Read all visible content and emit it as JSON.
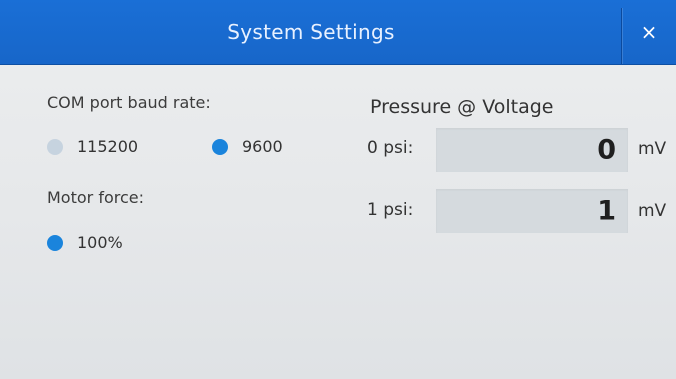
{
  "window": {
    "title": "System Settings",
    "close_glyph": "×"
  },
  "baud": {
    "label": "COM port baud rate:",
    "options": [
      {
        "label": "115200",
        "selected": false
      },
      {
        "label": "9600",
        "selected": true
      }
    ]
  },
  "motor": {
    "label": "Motor force:",
    "options": [
      {
        "label": "100%",
        "selected": true
      }
    ]
  },
  "pressure": {
    "heading": "Pressure @ Voltage",
    "rows": [
      {
        "label": "0 psi:",
        "value": "0",
        "unit": "mV"
      },
      {
        "label": "1 psi:",
        "value": "1",
        "unit": "mV"
      }
    ]
  },
  "colors": {
    "titlebar": "#1766c9",
    "radio_selected": "#1a84dc",
    "radio_unselected": "#c6d3df",
    "value_box": "#d5dade"
  },
  "icons": {
    "close": "close-icon"
  }
}
